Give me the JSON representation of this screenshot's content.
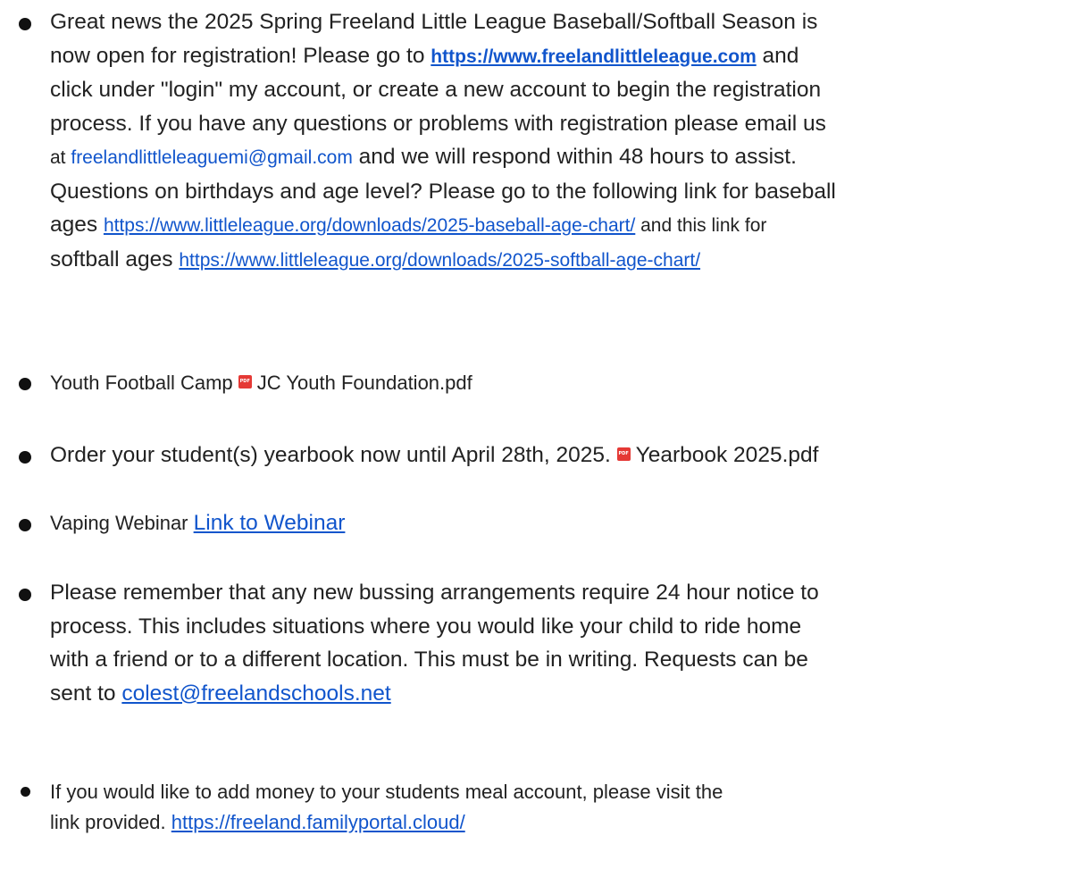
{
  "announcements": {
    "registration": {
      "line1": "Great news the 2025 Spring Freeland Little League Baseball/Softball Season is",
      "line2_before": "now open for registration! Please go to ",
      "league_link": "https://www.freelandlittleleague.com",
      "line2_after": " and",
      "line3": "click under \"login\" my account, or create a new account to begin the registration",
      "line4": "process. If you have any questions or problems with registration please email us",
      "line5_before": "at ",
      "email_link": "freelandlittleleaguemi@gmail.com",
      "line5_after": " and we will respond within 48 hours to assist.",
      "line6": "Questions on birthdays and age level? Please go to the following link for baseball",
      "line7_before": "ages ",
      "baseball_link": "https://www.littleleague.org/downloads/2025-baseball-age-chart/",
      "line7_after": " and this link for",
      "line8_before": "softball ages ",
      "softball_link": "https://www.littleleague.org/downloads/2025-softball-age-chart/"
    },
    "football": {
      "text": "Youth Football Camp ",
      "file": "JC Youth Foundation.pdf"
    },
    "yearbook": {
      "text": "Order your student(s) yearbook now until April 28th, 2025. ",
      "file": "Yearbook  2025.pdf"
    },
    "vaping": {
      "text": "Vaping Webinar ",
      "link": "Link to Webinar"
    },
    "bussing": {
      "line1": "Please remember that any new bussing arrangements require 24 hour notice to",
      "line2": "process.  This includes situations where you would like your child to ride home",
      "line3": "with a friend or to a different location. This must be in writing.  Requests can be",
      "line4_before": "sent to ",
      "email_link": "colest@freelandschools.net"
    },
    "meal": {
      "line1": "If you would like to add money to your students meal account, please visit the",
      "line2_before": "link provided. ",
      "link": "https://freeland.familyportal.cloud/"
    }
  }
}
